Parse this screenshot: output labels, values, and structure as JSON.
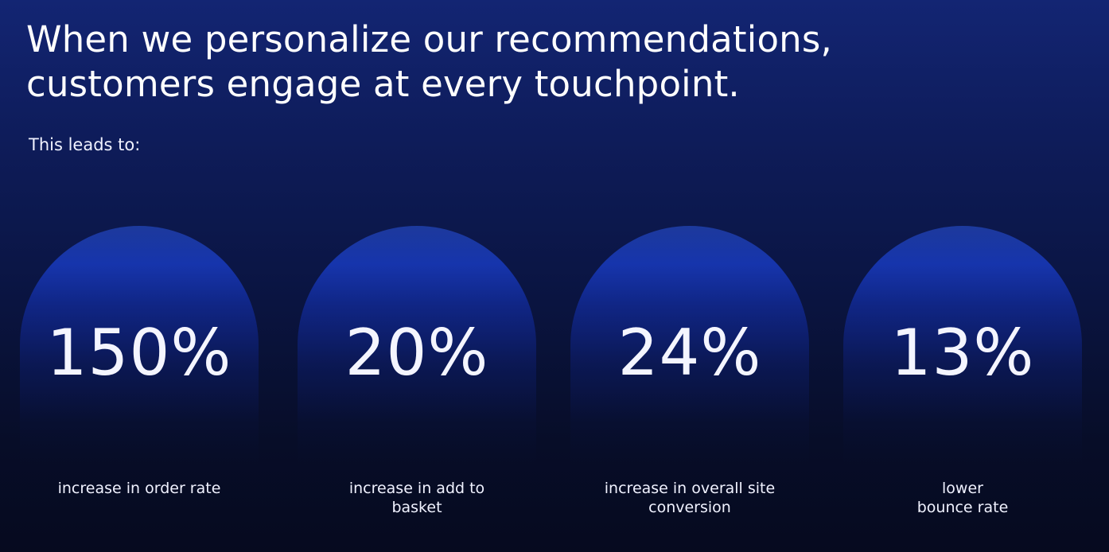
{
  "headline": {
    "line1": "When we personalize our recommendations,",
    "line2": "customers engage at every touchpoint."
  },
  "subhead": "This leads to:",
  "stats": [
    {
      "value": "150%",
      "label_line1": "increase in order rate",
      "label_line2": ""
    },
    {
      "value": "20%",
      "label_line1": "increase in add to",
      "label_line2": "basket"
    },
    {
      "value": "24%",
      "label_line1": "increase in overall site",
      "label_line2": "conversion"
    },
    {
      "value": "13%",
      "label_line1": "lower",
      "label_line2": "bounce rate"
    }
  ],
  "colors": {
    "background_top": "#132573",
    "background_bottom": "#060a1f",
    "arch_highlight": "#1a3bbf",
    "text": "#ffffff"
  }
}
